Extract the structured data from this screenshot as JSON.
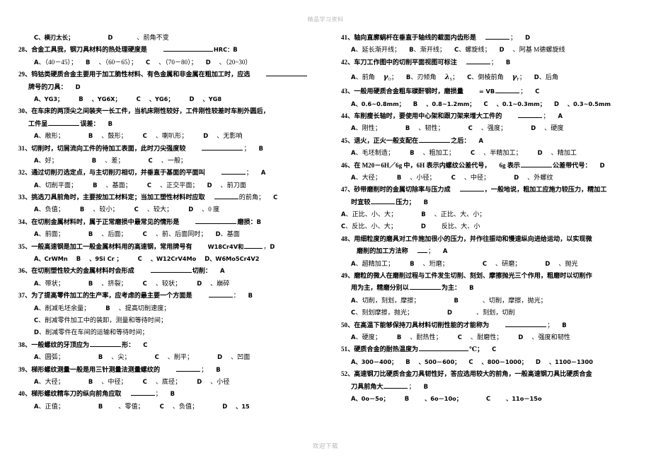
{
  "document": {
    "header_watermark": "精品学习资料",
    "footer_watermark": "欢迎下载"
  },
  "left_column": {
    "q27_tail": {
      "opt_c": "C、横刃太长；",
      "opt_d_letter": "D",
      "opt_d": "、前角不变"
    },
    "questions": [
      {
        "number": "28、",
        "stem": "合金工具我，钢刀具材料的热处理硬度是",
        "stem_tail": "HRC：",
        "answer": "B",
        "options_line": [
          {
            "letter": "A",
            "text": "、（40－45）；"
          },
          {
            "letter": "B",
            "text": "、（60－65）；"
          },
          {
            "letter": "C",
            "text": "、（70－80）；"
          },
          {
            "letter": "D",
            "text": "、（20~30）"
          }
        ]
      },
      {
        "number": "29、",
        "stem": "钨钴类硬质合金主要用于加工脆性材料、有色金属和非金属在粗加工时，应选",
        "stem_line2": "牌号的刀具：",
        "answer": "D",
        "options_line": [
          {
            "letter": "A",
            "text": "、YG3；"
          },
          {
            "letter": "B",
            "text": "、YG6X；"
          },
          {
            "letter": "C",
            "text": "、YG6；"
          },
          {
            "letter": "D",
            "text": "、YG8"
          }
        ]
      },
      {
        "number": "30、",
        "stem": "在车床的两顶尖之间装夹一长工件，当机床刚性较好，工件刚性较差时车削外圆后，",
        "stem_line2_pre": "工件呈",
        "stem_line2_post": "误差：",
        "answer": "B",
        "options_line": [
          {
            "letter": "A",
            "text": "、敝形；"
          },
          {
            "letter": "B",
            "text": "、鼓形；"
          },
          {
            "letter": "C",
            "text": "、喇叭形；"
          },
          {
            "letter": "D",
            "text": "、无影响"
          }
        ]
      },
      {
        "number": "31、",
        "stem": "切削时，切屑流向工件的待加工表面，此时刀尖强度较",
        "stem_tail": "；",
        "answer": "B",
        "options_line": [
          {
            "letter": "A",
            "text": "、好；"
          },
          {
            "letter": "B",
            "text": "、差；"
          },
          {
            "letter": "C",
            "text": "、一般；"
          }
        ]
      },
      {
        "number": "32、",
        "stem": "通过切削刃选定点，与主切削刃相切，并垂直于基面的平面叫",
        "stem_tail": "；",
        "answer": "A",
        "options_line": [
          {
            "letter": "A",
            "text": "、切削平面；"
          },
          {
            "letter": "B",
            "text": "、基面；"
          },
          {
            "letter": "C",
            "text": "、正交平面；"
          },
          {
            "letter": "D",
            "text": "、前刀面"
          }
        ]
      },
      {
        "number": "33、",
        "stem": "挑选刀具前角时，主要按加工材料定；当加工塑性材料时应取",
        "stem_tail": "的前角；",
        "answer": "C",
        "options_line": [
          {
            "letter": "A",
            "text": "、负值；"
          },
          {
            "letter": "B",
            "text": "、较小；"
          },
          {
            "letter": "C",
            "text": "、较大；"
          },
          {
            "letter": "D",
            "text": "、0 度"
          }
        ]
      },
      {
        "number": "34、",
        "stem": "在切削金属材料时，属于正常磨损中最常见的情形是",
        "stem_tail": "磨损：",
        "answer": "B",
        "options_line": [
          {
            "letter": "A",
            "text": "、前面；"
          },
          {
            "letter": "B",
            "text": "、后面；"
          },
          {
            "letter": "C",
            "text": "、前、后面同时；"
          },
          {
            "letter": "D",
            "text": "、基面"
          }
        ]
      },
      {
        "number": "35、",
        "stem": "一般高速钢是加工一般金属材料用的高速钢，常用牌号有",
        "stem_tail": "W18Cr4V和",
        "stem_tail2": "，",
        "answer": "D",
        "options_line": [
          {
            "letter": "A",
            "text": "、CrWMn"
          },
          {
            "letter": "B",
            "text": "、9Si Cr ；"
          },
          {
            "letter": "C",
            "text": "、W12CrV4Mo"
          },
          {
            "letter": "D",
            "text": "、W6Mo5Cr4V2"
          }
        ]
      },
      {
        "number": "36、",
        "stem": "在切削塑性较大的金属材料时会形成",
        "stem_tail": "切削：",
        "answer": "A",
        "options_line": [
          {
            "letter": "A",
            "text": "、带状；"
          },
          {
            "letter": "B",
            "text": "、挤裂；"
          },
          {
            "letter": "C",
            "text": "、较状；"
          },
          {
            "letter": "D",
            "text": "、崩碎"
          }
        ]
      },
      {
        "number": "37、",
        "stem": "为了提高零件加工的生产率，应考虑的最主要一个方面是",
        "stem_tail": "：",
        "answer": "B",
        "options_stacked": [
          {
            "letter": "A",
            "text": "、削减毛坯余量；",
            "letter2": "B",
            "text2": "、提高切削速度；"
          },
          {
            "letter": "C",
            "text": "、削减零件加工中的装卸，测量和等待时间；"
          },
          {
            "letter": "D",
            "text": "、削减零件在车间的运输和等待时间；"
          }
        ]
      },
      {
        "number": "38、",
        "stem_pre": "一般螺纹的牙顶应为",
        "stem_post": "形：",
        "answer": "C",
        "options_line": [
          {
            "letter": "A",
            "text": "、圆弧；"
          },
          {
            "letter": "B",
            "text": "、尖；"
          },
          {
            "letter": "C",
            "text": "、削平；"
          },
          {
            "letter": "D",
            "text": "、凹面"
          }
        ]
      },
      {
        "number": "39、",
        "stem": "梯形螺纹测量一般是用三针测量法测量螺纹的",
        "stem_tail": "；",
        "answer": "B",
        "options_line": [
          {
            "letter": "A",
            "text": "、大径；"
          },
          {
            "letter": "B",
            "text": "、中径；"
          },
          {
            "letter": "C",
            "text": "、底径；"
          },
          {
            "letter": "D",
            "text": "、小径"
          }
        ]
      },
      {
        "number": "40、",
        "stem": "梯形螺纹精车刀的纵向前角应取",
        "stem_tail": "；",
        "answer": "B",
        "options_line": [
          {
            "letter": "A",
            "text": "、正值；"
          },
          {
            "letter": "B",
            "text": "、零值；"
          },
          {
            "letter": "C",
            "text": "、负值；"
          },
          {
            "letter": "D",
            "text": "、15"
          }
        ]
      }
    ]
  },
  "right_column": {
    "questions": [
      {
        "number": "41、",
        "stem": "轴向直廓蜗杆在垂直于轴线的截面内齿形是",
        "stem_tail": "；",
        "answer": "D",
        "options_line": [
          {
            "letter": "A",
            "text": "、延长渐开线；"
          },
          {
            "letter": "B",
            "text": "、渐开线；"
          },
          {
            "letter": "C",
            "text": "、螺旋线；"
          },
          {
            "letter": "D",
            "text": "、阿基 M德螺旋线"
          }
        ]
      },
      {
        "number": "42、",
        "stem": "车刀工作图中的切削平面视图可标注",
        "stem_tail": "；",
        "answer": "B",
        "options_greek": [
          {
            "letter": "A",
            "text": "、前角",
            "sym": "γ",
            "subs": "O",
            "tail": "；"
          },
          {
            "letter": "B",
            "text": "、刃倾角",
            "sym": "λ",
            "subs": "S",
            "tail": "；"
          },
          {
            "letter": "C",
            "text": "、倒棱前角",
            "sym": "γ",
            "subs": "F",
            "tail": "；"
          },
          {
            "letter": "D",
            "text": "、后角",
            "sym": "",
            "subs": "",
            "tail": ""
          }
        ]
      },
      {
        "number": "43、",
        "stem": "一般用硬质合金粗车碳酐钢时，磨损量",
        "stem_mid": "= VB",
        "stem_tail": "；",
        "answer": "C",
        "options_line": [
          {
            "letter": "A",
            "text": "、0.6~0.8mm；"
          },
          {
            "letter": "B",
            "text": "、0.8~1.2mm；"
          },
          {
            "letter": "C",
            "text": "、0.1~0.3mm；"
          },
          {
            "letter": "D",
            "text": "、0.3~0.5mm"
          }
        ]
      },
      {
        "number": "44、",
        "stem": "车削瘦长轴时，要使用中心架和跟刀架来增大工件的",
        "stem_tail": "；",
        "answer": "A",
        "options_line": [
          {
            "letter": "A",
            "text": "、刚性；"
          },
          {
            "letter": "B",
            "text": "、韧性；"
          },
          {
            "letter": "C",
            "text": "、强度；"
          },
          {
            "letter": "D",
            "text": "、硬度"
          }
        ]
      },
      {
        "number": "45、",
        "stem_pre": "退火，正火一般支配在",
        "stem_post": "之后：",
        "answer": "A",
        "options_line": [
          {
            "letter": "A",
            "text": "、毛坯制造；"
          },
          {
            "letter": "B",
            "text": "、粗加工；"
          },
          {
            "letter": "C",
            "text": "、半精加工；"
          },
          {
            "letter": "D",
            "text": "、精加工"
          }
        ]
      },
      {
        "number": "46、",
        "stem": "在 M20－6H／6g 中，6H 表示内螺纹公差代号，",
        "stem_mid": "6g 表示",
        "stem_tail": "公差带代号：",
        "answer": "D",
        "options_line": [
          {
            "letter": "A",
            "text": "、大径；"
          },
          {
            "letter": "B",
            "text": "、小径；"
          },
          {
            "letter": "C",
            "text": "、中径；"
          },
          {
            "letter": "D",
            "text": "、外螺纹"
          }
        ]
      },
      {
        "number": "47、",
        "stem": "砂带磨削时的金属切除率与压力成",
        "stem_tail": "，一般地说，粗加工应施力较压力，精加工",
        "stem_line2_pre": "时宜较",
        "stem_line2_post": "压力；",
        "answer": "B",
        "options_stacked2": [
          {
            "letter": "A",
            "text": "、正比、小、大；",
            "letter2": "B",
            "text2": "、正比、大、小；"
          },
          {
            "letter": "C",
            "text": "、反比、小、大；",
            "letter2": "D",
            "text2": "反比、大、小"
          }
        ]
      },
      {
        "number": "48、",
        "stem": "用细粒度的磨具对工件施加很小的压力，并作往振动和慢速纵向进给运动，以实现微",
        "stem_line2": "磨削的加工方法称",
        "stem_line2_tail": "；",
        "answer": "A",
        "options_line": [
          {
            "letter": "A",
            "text": "、超精加工；"
          },
          {
            "letter": "B",
            "text": "、珩磨；"
          },
          {
            "letter": "C",
            "text": "、研磨；"
          },
          {
            "letter": "D",
            "text": "、抛光"
          }
        ]
      },
      {
        "number": "49、",
        "stem": "磨粒的微人在磨削过程与工件发生切削、刻划、摩擦抛光三个作用，粗磨时以切削作",
        "stem_line2_pre": "用为主，精磨分别以",
        "stem_line2_post": "为主：",
        "answer": "B",
        "options_stacked2": [
          {
            "letter": "A",
            "text": "、切削，刻划，摩擦；",
            "letter2": "B",
            "text2": "、切削，摩擦，抛光；"
          },
          {
            "letter": "C",
            "text": "、刻划摩擦，抛光；",
            "letter2": "D",
            "text2": "、刻划，切削"
          }
        ]
      },
      {
        "number": "50、",
        "stem": "在高温下能够保持刀具材料切削性能的才能称为",
        "stem_tail": "；",
        "answer": "B",
        "options_line": [
          {
            "letter": "A",
            "text": "、硬度；"
          },
          {
            "letter": "B",
            "text": "、耐热性；"
          },
          {
            "letter": "C",
            "text": "、耐磨性；"
          },
          {
            "letter": "D",
            "text": "、强度和韧性"
          }
        ]
      },
      {
        "number": "51、",
        "stem_pre": "硬质合金的耐热温度为",
        "stem_post": "℃；",
        "answer": "C",
        "options_line": [
          {
            "letter": "A",
            "text": "、300－400；"
          },
          {
            "letter": "B",
            "text": "、500－600；"
          },
          {
            "letter": "C",
            "text": "、800－1000；"
          },
          {
            "letter": "D",
            "text": "、1100－1300"
          }
        ]
      },
      {
        "number": "52、",
        "stem": "高速钢刀比硬质合金刀具韧性好，答应选用较大的前角，一般高速钢刀具比硬质合金",
        "stem_line2_pre": "刀具前角大",
        "stem_line2_post": "；",
        "answer": "B",
        "options_line": [
          {
            "letter": "A",
            "text": "、0o－5o；"
          },
          {
            "letter": "B",
            "text": "、6o－10o；"
          },
          {
            "letter": "C",
            "text": "、11o－15o"
          }
        ]
      }
    ]
  }
}
